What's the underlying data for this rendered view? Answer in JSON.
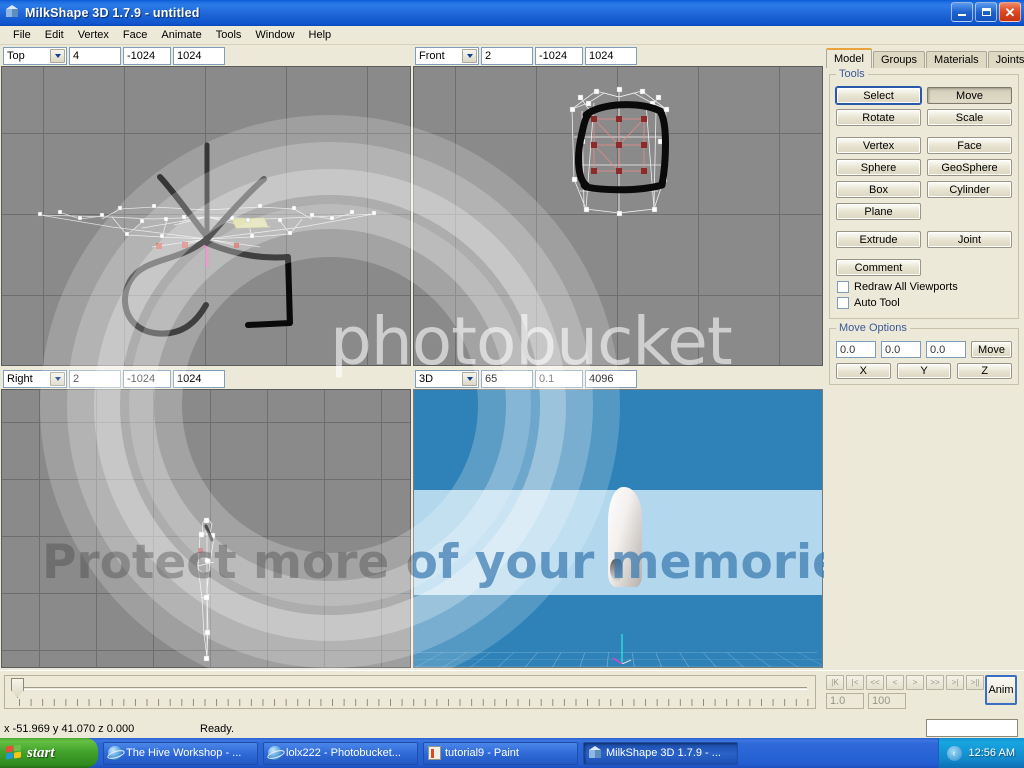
{
  "window": {
    "title": "MilkShape 3D 1.7.9 - untitled",
    "icon": "milkshape-cube-icon",
    "controls": {
      "minimize": "minimize",
      "maximize": "restore",
      "close": "close"
    }
  },
  "menu": {
    "items": [
      "File",
      "Edit",
      "Vertex",
      "Face",
      "Animate",
      "Tools",
      "Window",
      "Help"
    ]
  },
  "viewports": [
    {
      "name": "top",
      "view": "Top",
      "field1": "4",
      "field2": "-1024",
      "field3": "1024"
    },
    {
      "name": "front",
      "view": "Front",
      "field1": "2",
      "field2": "-1024",
      "field3": "1024"
    },
    {
      "name": "right",
      "view": "Right",
      "field1": "2",
      "field2": "-1024",
      "field3": "1024"
    },
    {
      "name": "3d",
      "view": "3D",
      "field1": "65",
      "field2": "0.1",
      "field3": "4096"
    }
  ],
  "panel": {
    "tabs": [
      {
        "label": "Model",
        "active": true
      },
      {
        "label": "Groups",
        "active": false
      },
      {
        "label": "Materials",
        "active": false
      },
      {
        "label": "Joints",
        "active": false
      }
    ],
    "tools_group": {
      "legend": "Tools",
      "buttons": [
        {
          "label": "Select",
          "state": "focus"
        },
        {
          "label": "Move",
          "state": "pressed"
        },
        {
          "label": "Rotate",
          "state": "normal"
        },
        {
          "label": "Scale",
          "state": "normal"
        },
        {
          "label": "Vertex",
          "state": "normal"
        },
        {
          "label": "Face",
          "state": "normal"
        },
        {
          "label": "Sphere",
          "state": "normal"
        },
        {
          "label": "GeoSphere",
          "state": "normal"
        },
        {
          "label": "Box",
          "state": "normal"
        },
        {
          "label": "Cylinder",
          "state": "normal"
        },
        {
          "label": "Plane",
          "state": "normal"
        },
        {
          "label": "Extrude",
          "state": "normal"
        },
        {
          "label": "Joint",
          "state": "normal"
        }
      ],
      "comment_label": "Comment",
      "checkboxes": [
        {
          "label": "Redraw All Viewports",
          "checked": false
        },
        {
          "label": "Auto Tool",
          "checked": false
        }
      ]
    },
    "move_options": {
      "legend": "Move Options",
      "x_value": "0.0",
      "y_value": "0.0",
      "z_value": "0.0",
      "move_label": "Move",
      "axis_buttons": [
        "X",
        "Y",
        "Z"
      ]
    }
  },
  "bottom": {
    "animation_controls": {
      "transport": [
        "|K",
        "|<",
        "<<",
        "<",
        ">",
        ">>",
        ">|",
        ">||"
      ],
      "frame_value": "1.0",
      "total_value": "100",
      "anim_label": "Anim"
    },
    "status": {
      "coordinates": "x -51.969 y 41.070 z 0.000",
      "message": "Ready."
    }
  },
  "taskbar": {
    "start_label": "start",
    "tasks": [
      {
        "label": "The Hive Workshop - ...",
        "icon": "ie-icon",
        "active": false
      },
      {
        "label": "lolx222 - Photobucket...",
        "icon": "ie-icon",
        "active": false
      },
      {
        "label": "tutorial9 - Paint",
        "icon": "paint-icon",
        "active": false
      },
      {
        "label": "MilkShape 3D 1.7.9 - ...",
        "icon": "milkshape-icon",
        "active": true
      }
    ],
    "clock": "12:56 AM"
  },
  "watermark": {
    "brand": "photobucket",
    "tagline": "Protect more of your memories for less!"
  },
  "colors": {
    "titlebar_blue": "#1f6fe0",
    "panel_bg": "#ece9d8",
    "viewport_bg": "#8a8a8a",
    "viewport_grid": "#6e6e6e",
    "accent_orange": "#e8a33d",
    "sky_blue": "#2f82b7",
    "sky_light": "#b3d8ee",
    "selected_vertex": "#b03a3a",
    "taskbar_blue": "#2f6ad8",
    "start_green": "#44a32c"
  }
}
